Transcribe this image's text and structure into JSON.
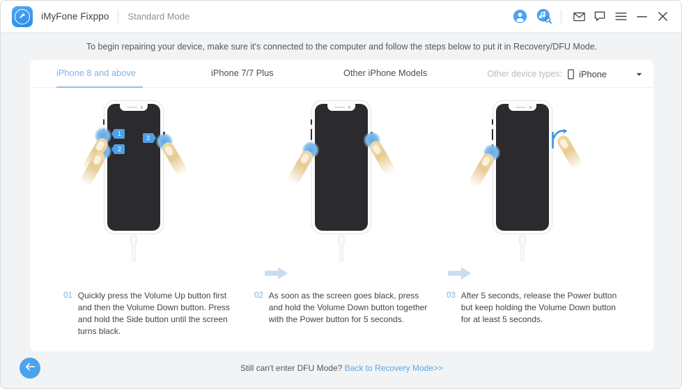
{
  "titlebar": {
    "brand": "iMyFone Fixppo",
    "mode": "Standard Mode",
    "icons": {
      "avatar": "user-avatar-icon",
      "music": "music-search-icon",
      "mail": "mail-icon",
      "feedback": "chat-bubble-icon",
      "menu": "hamburger-menu-icon",
      "minimize": "minimize-icon",
      "close": "close-icon"
    }
  },
  "instruction": "To begin repairing your device, make sure it's connected to the computer and follow the steps below to put it in Recovery/DFU Mode.",
  "tabs": [
    {
      "label": "iPhone 8 and above",
      "active": true
    },
    {
      "label": "iPhone 7/7 Plus",
      "active": false
    },
    {
      "label": "Other iPhone Models",
      "active": false
    }
  ],
  "device_types": {
    "label": "Other device types:",
    "value": "iPhone",
    "icon": "phone-icon",
    "caret": "chevron-down-icon"
  },
  "steps": [
    {
      "num": "01",
      "text": "Quickly press the Volume Up button first and then the Volume Down button. Press and hold the Side button until the screen turns black.",
      "badges": [
        "1",
        "2",
        "3"
      ]
    },
    {
      "num": "02",
      "text": "As soon as the screen goes black, press and hold the Volume Down button together with the Power button for 5 seconds.",
      "badges": []
    },
    {
      "num": "03",
      "text": "After 5 seconds, release the Power button but keep holding the Volume Down button for at least 5 seconds.",
      "badges": []
    }
  ],
  "footer": {
    "back_icon": "back-arrow-icon",
    "question": "Still can't enter DFU Mode?",
    "link": "Back to Recovery Mode>>"
  },
  "colors": {
    "accent": "#4ba3ec",
    "tab_active": "#7db3e8",
    "screen": "#2b2b2d",
    "flow_arrow": "#ccdcee",
    "page_bg": "#f2f3f5"
  }
}
